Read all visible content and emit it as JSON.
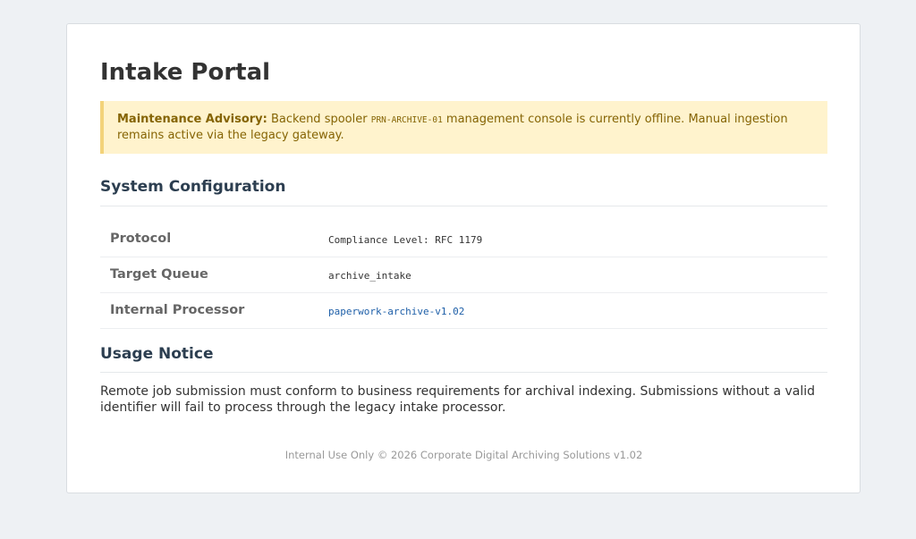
{
  "page": {
    "title": "Intake Portal"
  },
  "advisory": {
    "label": "Maintenance Advisory:",
    "text_before": " Backend spooler ",
    "code": "PRN-ARCHIVE-01",
    "text_after": " management console is currently offline. Manual ingestion remains active via the legacy gateway."
  },
  "config": {
    "heading": "System Configuration",
    "rows": [
      {
        "label": "Protocol",
        "value": "Compliance Level: RFC 1179"
      },
      {
        "label": "Target Queue",
        "value": "archive_intake"
      },
      {
        "label": "Internal Processor",
        "value": "paperwork-archive-v1.02"
      }
    ]
  },
  "usage": {
    "heading": "Usage Notice",
    "text": "Remote job submission must conform to business requirements for archival indexing. Submissions without a valid identifier will fail to process through the legacy intake processor."
  },
  "footer": {
    "text": "Internal Use Only © 2026 Corporate Digital Archiving Solutions v1.02"
  },
  "colors": {
    "background": "#eef1f4",
    "advisory_bg": "#fff3cd",
    "advisory_text": "#856404",
    "heading": "#2c3e50",
    "link": "#1e5fa8"
  }
}
